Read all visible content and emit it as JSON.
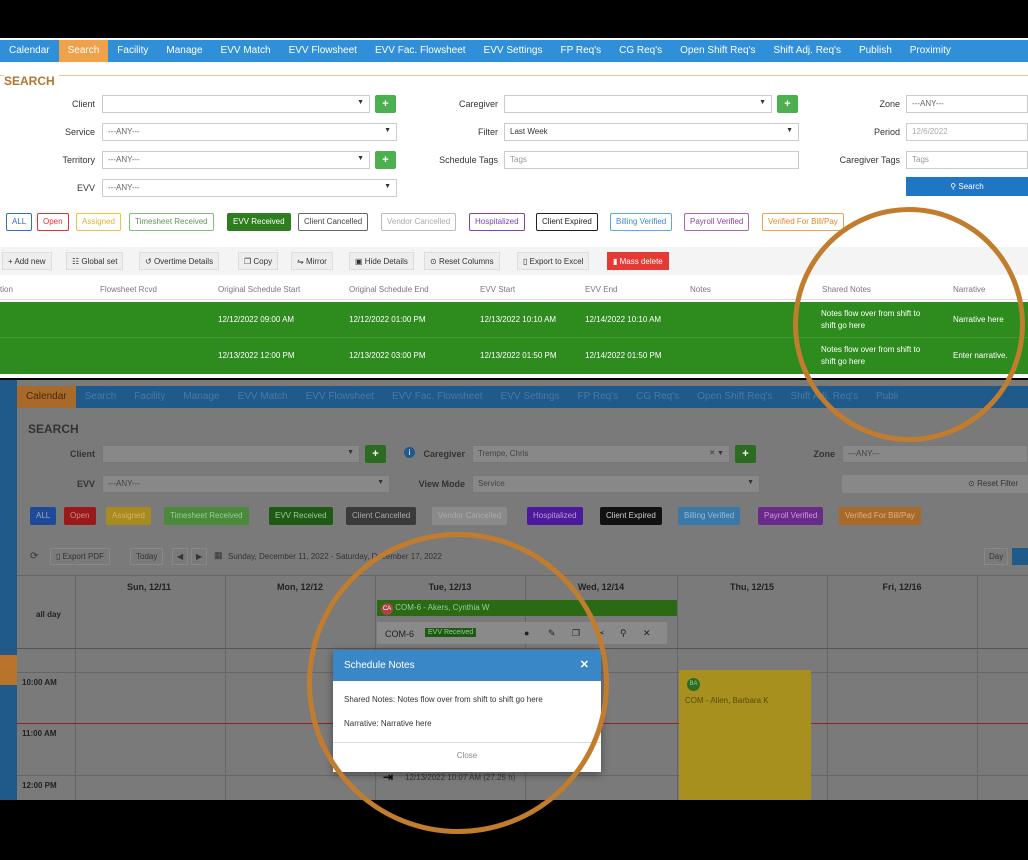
{
  "top": {
    "nav": [
      "Calendar",
      "Search",
      "Facility",
      "Manage",
      "EVV Match",
      "EVV Flowsheet",
      "EVV Fac. Flowsheet",
      "EVV Settings",
      "FP Req's",
      "CG Req's",
      "Open Shift Req's",
      "Shift Adj. Req's",
      "Publish",
      "Proximity"
    ],
    "search_title": "SEARCH",
    "labels": {
      "client": "Client",
      "service": "Service",
      "territory": "Territory",
      "evv": "EVV",
      "caregiver": "Caregiver",
      "filter": "Filter",
      "schedule_tags": "Schedule Tags",
      "zone": "Zone",
      "period": "Period",
      "caregiver_tags": "Caregiver Tags"
    },
    "values": {
      "service": "---ANY---",
      "territory": "---ANY---",
      "evv": "---ANY---",
      "filter": "Last Week",
      "schedule_tags_placeholder": "Tags",
      "zone": "---ANY---",
      "period": "12/6/2022",
      "caregiver_tags_placeholder": "Tags"
    },
    "search_button": "Search",
    "chips": [
      "ALL",
      "Open",
      "Assigned",
      "Timesheet Received",
      "EVV Received",
      "Client Cancelled",
      "Vendor Cancelled",
      "Hospitalized",
      "Client Expired",
      "Billing Verified",
      "Payroll Verified",
      "Verified For Bill/Pay"
    ],
    "toolbar": [
      "Add new",
      "Global set",
      "Overtime Details",
      "Copy",
      "Mirror",
      "Hide Details",
      "Reset Columns",
      "Export to Excel",
      "Mass delete"
    ],
    "columns": [
      "tion",
      "Flowsheet Rcvd",
      "Original Schedule Start",
      "Original Schedule End",
      "EVV Start",
      "EVV End",
      "Notes",
      "Shared Notes",
      "Narrative"
    ],
    "rows": [
      {
        "orig_start": "12/12/2022 09:00 AM",
        "orig_end": "12/12/2022 01:00 PM",
        "evv_start": "12/13/2022 10:10 AM",
        "evv_end": "12/14/2022 10:10 AM",
        "shared": "Notes flow over from shift to shift go here",
        "narrative": "Narrative here"
      },
      {
        "orig_start": "12/13/2022 12:00 PM",
        "orig_end": "12/13/2022 03:00 PM",
        "evv_start": "12/13/2022 01:50 PM",
        "evv_end": "12/14/2022 01:50 PM",
        "shared": "Notes flow over from shift to shift go here",
        "narrative": "Enter narrative."
      }
    ]
  },
  "bottom": {
    "nav": [
      "Calendar",
      "Search",
      "Facility",
      "Manage",
      "EVV Match",
      "EVV Flowsheet",
      "EVV Fac. Flowsheet",
      "EVV Settings",
      "FP Req's",
      "CG Req's",
      "Open Shift Req's",
      "Shift Adj. Req's",
      "Publi"
    ],
    "search_title": "SEARCH",
    "labels": {
      "client": "Client",
      "caregiver": "Caregiver",
      "zone": "Zone",
      "evv": "EVV",
      "view_mode": "View Mode"
    },
    "values": {
      "caregiver": "Trempe, Chris",
      "zone": "---ANY---",
      "evv": "---ANY---",
      "view_mode": "Service"
    },
    "reset_filter": "Reset Filter",
    "chips": [
      "ALL",
      "Open",
      "Assigned",
      "Timesheet Received",
      "EVV Received",
      "Client Cancelled",
      "Vendor Cancelled",
      "Hospitalized",
      "Client Expired",
      "Billing Verified",
      "Payroll Verified",
      "Verified For Bill/Pay"
    ],
    "export_pdf": "Export PDF",
    "today": "Today",
    "date_range": "Sunday, December 11, 2022 - Saturday, December 17, 2022",
    "day_btn": "Day",
    "days": [
      "Sun, 12/11",
      "Mon, 12/12",
      "Tue, 12/13",
      "Wed, 12/14",
      "Thu, 12/15",
      "Fri, 12/16"
    ],
    "all_day": "all day",
    "times": [
      "10:00 AM",
      "11:00 AM",
      "12:00 PM"
    ],
    "event_allday": "COM-6 - Akers, Cynthia W",
    "event_allday_badge": "CA",
    "event_code": "COM-6",
    "event_badge": "EVV Received",
    "thu_badge": "BA",
    "thu_event": "COM - Allen, Barbara K",
    "bottom_event": "12/13/2022 10:07 AM (27.25 h)",
    "modal": {
      "title": "Schedule Notes",
      "shared": "Shared Notes: Notes flow over from shift to shift go here",
      "narrative": "Narrative: Narrative here",
      "close": "Close"
    }
  },
  "colors": {
    "nav_blue": "#2f8fd8",
    "active_tab": "#f0a24a",
    "green_row": "#2e8b1e",
    "highlight": "#c27c2e",
    "modal_header": "#3a87c8"
  }
}
